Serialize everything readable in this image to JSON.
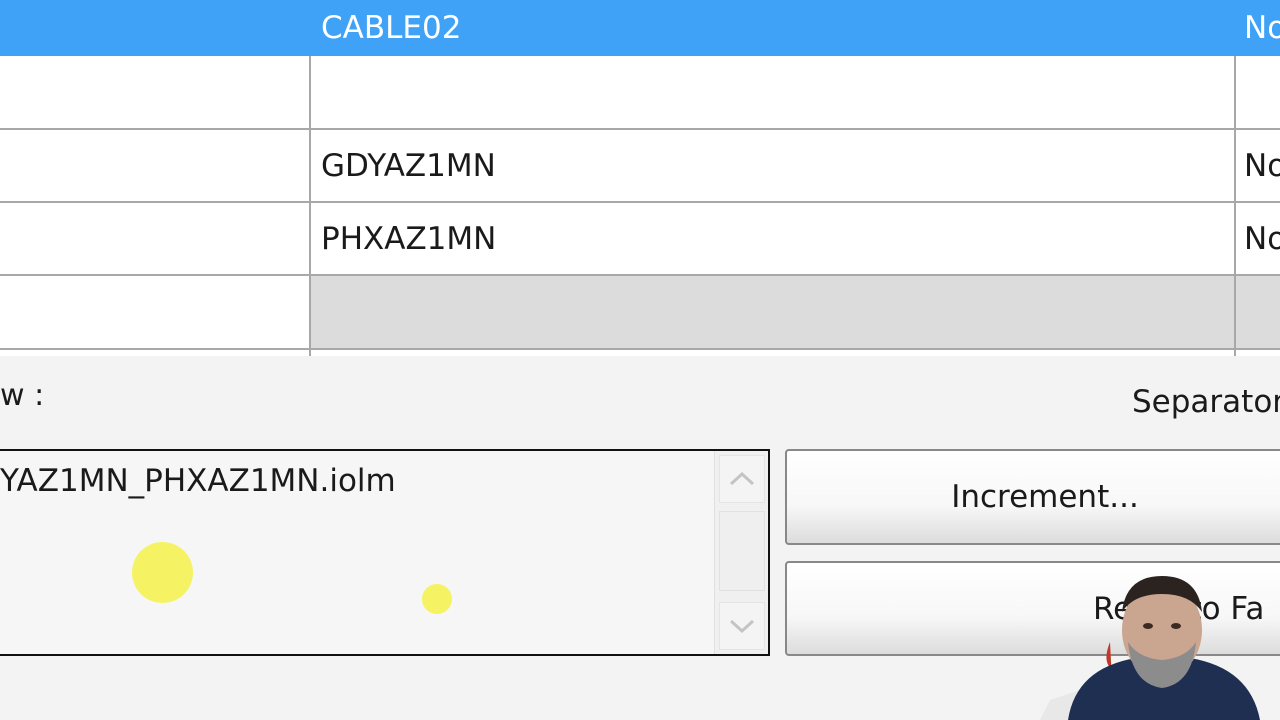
{
  "grid": {
    "rows": [
      {
        "col1": "",
        "col2": "CABLE02",
        "col3": "No",
        "state": "selected"
      },
      {
        "col1": "",
        "col2": "",
        "col3": "",
        "state": "normal"
      },
      {
        "col1": "",
        "col2": "GDYAZ1MN",
        "col3": "No",
        "state": "normal"
      },
      {
        "col1": "",
        "col2": "PHXAZ1MN",
        "col3": "No",
        "state": "normal"
      },
      {
        "col1": "",
        "col2": "",
        "col3": "",
        "state": "gray"
      }
    ]
  },
  "preview": {
    "label": "w :",
    "text": "YAZ1MN_PHXAZ1MN.iolm"
  },
  "separator": {
    "label": "Separator"
  },
  "buttons": {
    "increment": "Increment...",
    "reset": "Reset to Fa"
  },
  "icons": {
    "scroll_up": "chevron-up-icon",
    "scroll_down": "chevron-down-icon"
  },
  "colors": {
    "selection": "#3fa2f7",
    "highlight_dot": "#f5f363"
  }
}
